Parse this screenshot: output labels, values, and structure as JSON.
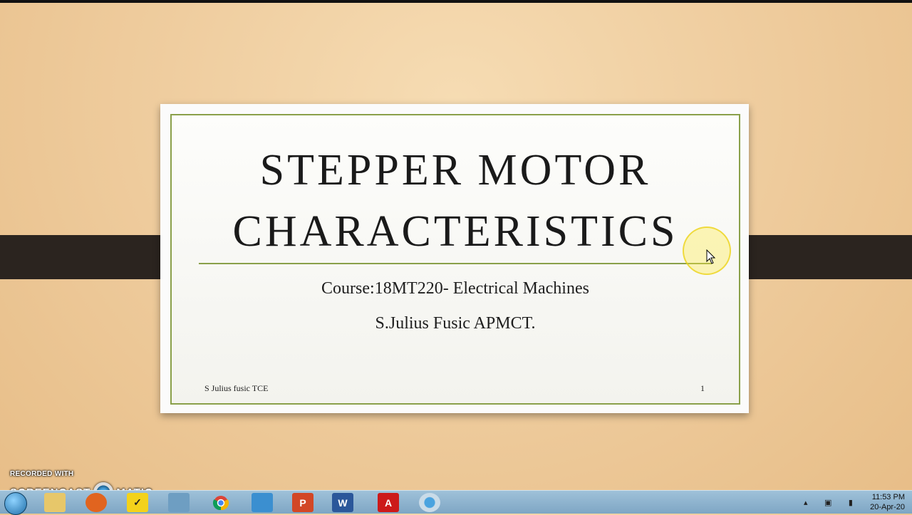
{
  "slide": {
    "title_line1": "STEPPER MOTOR",
    "title_line2": "CHARACTERISTICS",
    "course": "Course:18MT220- Electrical Machines",
    "author": "S.Julius Fusic APMCT.",
    "footer_left": "S Julius fusic TCE",
    "page_number": "1"
  },
  "watermark": {
    "line1": "RECORDED WITH",
    "line2_left": "SCREENCAST",
    "line2_right": "MATIC"
  },
  "taskbar": {
    "icons": [
      "start-orb-icon",
      "file-explorer-icon",
      "firefox-icon",
      "norton-icon",
      "folder-icon",
      "chrome-icon",
      "image-viewer-icon",
      "powerpoint-icon",
      "word-icon",
      "acrobat-icon",
      "screencast-icon"
    ],
    "time": "11:53 PM",
    "date": "20-Apr-20"
  },
  "colors": {
    "accent": "#8aa04a",
    "band": "#2b241f"
  }
}
